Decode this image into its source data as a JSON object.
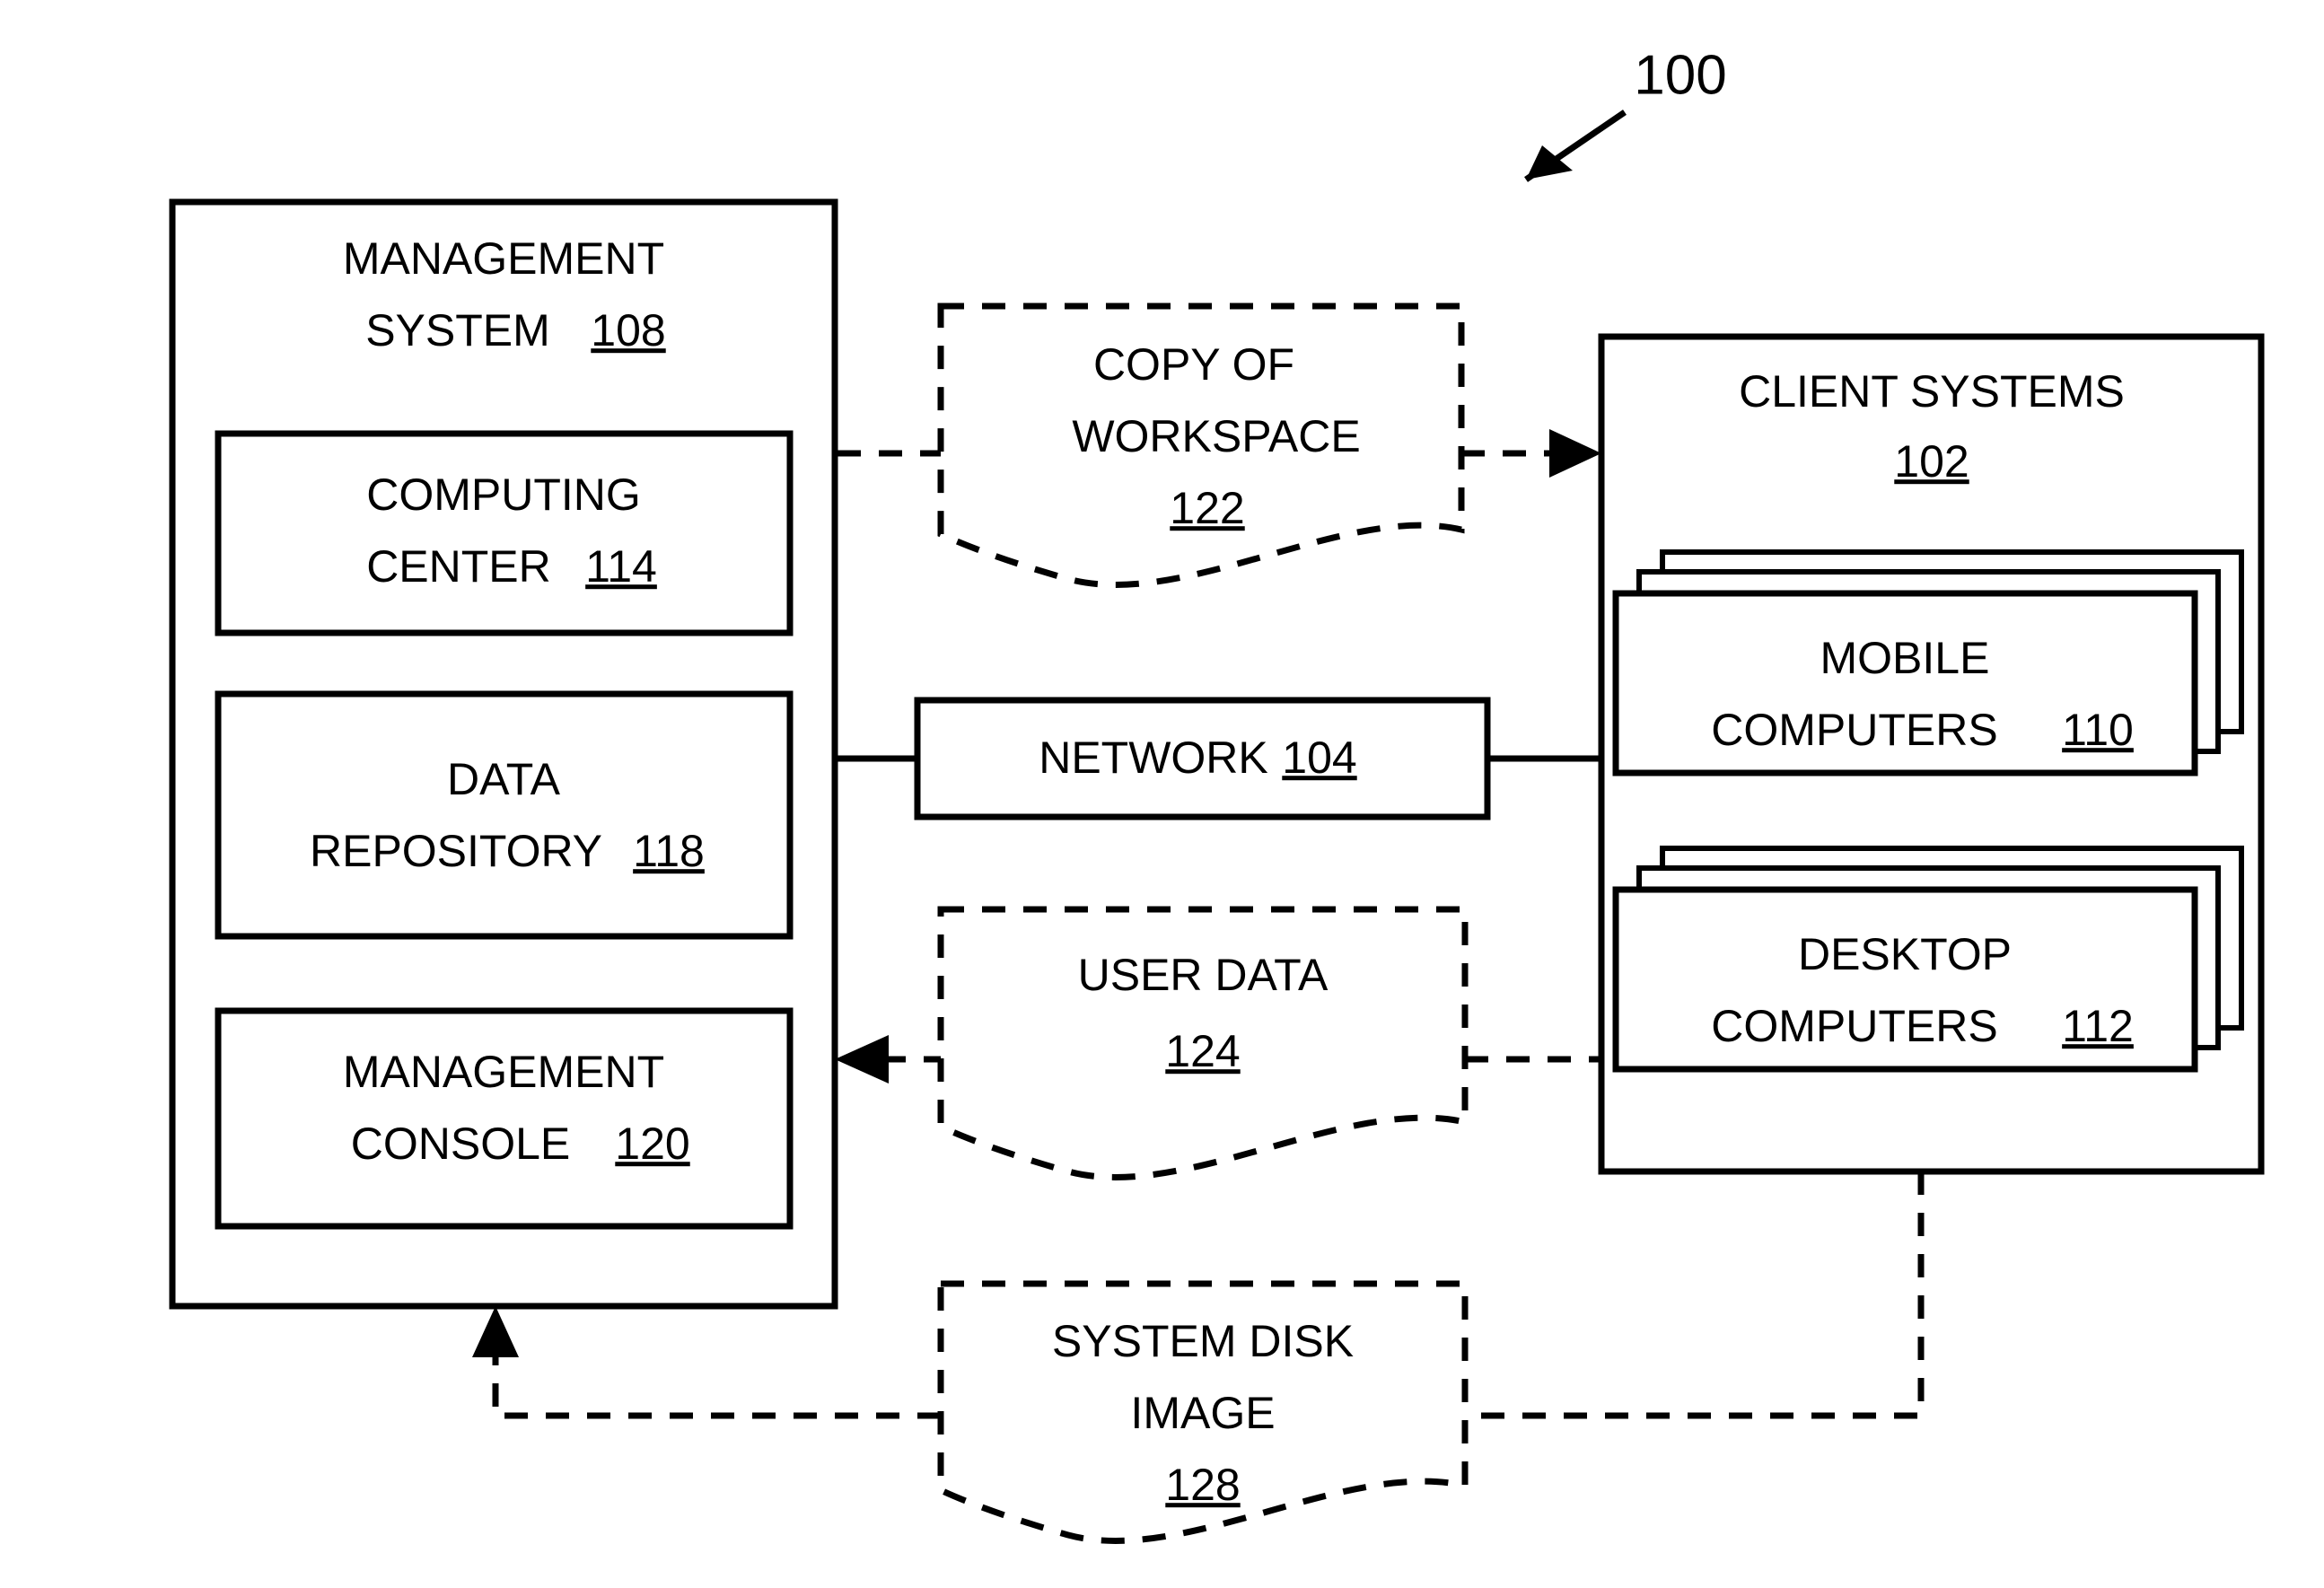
{
  "figure": {
    "number": "100"
  },
  "nodes": {
    "management_system": {
      "label_line1": "MANAGEMENT",
      "label_line2": "SYSTEM",
      "ref": "108"
    },
    "computing_center": {
      "label_line1": "COMPUTING",
      "label_line2": "CENTER",
      "ref": "114"
    },
    "data_repository": {
      "label_line1": "DATA",
      "label_line2": "REPOSITORY",
      "ref": "118"
    },
    "management_console": {
      "label_line1": "MANAGEMENT",
      "label_line2": "CONSOLE",
      "ref": "120"
    },
    "network": {
      "label_line1": "NETWORK",
      "ref": "104"
    },
    "client_systems": {
      "label_line1": "CLIENT SYSTEMS",
      "ref": "102"
    },
    "mobile_computers": {
      "label_line1": "MOBILE",
      "label_line2": "COMPUTERS",
      "ref": "110"
    },
    "desktop_computers": {
      "label_line1": "DESKTOP",
      "label_line2": "COMPUTERS",
      "ref": "112"
    },
    "copy_of_workspace": {
      "label_line1": "COPY OF",
      "label_line2": "WORKSPACE",
      "ref": "122"
    },
    "user_data": {
      "label_line1": "USER DATA",
      "ref": "124"
    },
    "system_disk_image": {
      "label_line1": "SYSTEM DISK",
      "label_line2": "IMAGE",
      "ref": "128"
    }
  },
  "colors": {
    "ink": "#000000",
    "paper": "#ffffff"
  }
}
